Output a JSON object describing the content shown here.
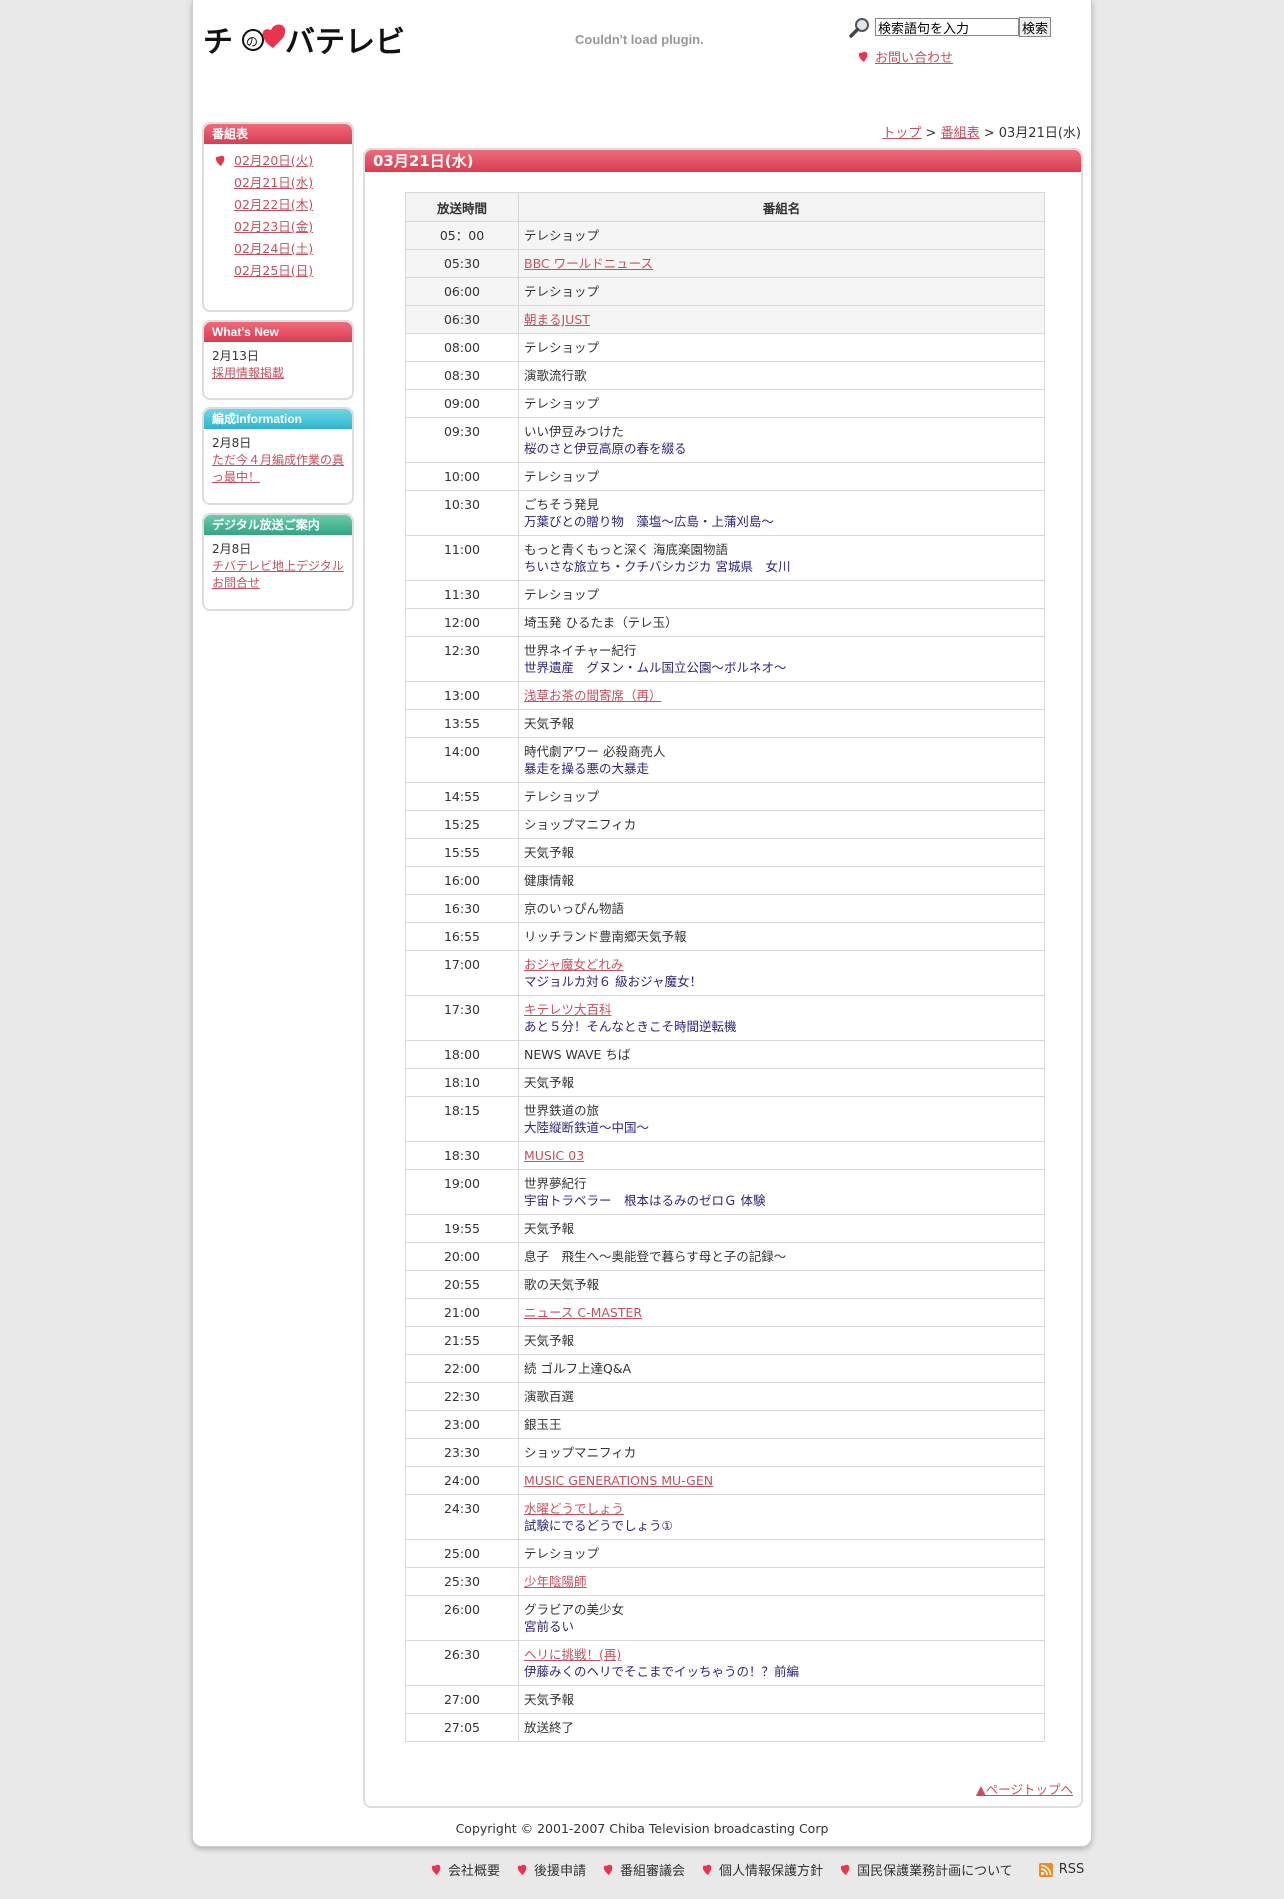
{
  "header": {
    "logo_text": "チバテレビ",
    "plugin_message": "Couldn't load plugin.",
    "search_placeholder": "検索語句を入力",
    "search_button": "検索",
    "contact_link": "お問い合わせ"
  },
  "sidebar": {
    "schedule": {
      "title": "番組表",
      "days": [
        "02月20日(火)",
        "02月21日(水)",
        "02月22日(木)",
        "02月23日(金)",
        "02月24日(土)",
        "02月25日(日)"
      ]
    },
    "whats_new": {
      "title": "What's New",
      "date": "2月13日",
      "link": "採用情報掲載"
    },
    "info": {
      "title": "編成Information",
      "date": "2月8日",
      "link": "ただ今４月編成作業の真っ最中！"
    },
    "digital": {
      "title": "デジタル放送ご案内",
      "date": "2月8日",
      "link": "チバテレビ地上デジタルお問合せ"
    }
  },
  "breadcrumb": {
    "top": "トップ",
    "sep1": " > ",
    "schedule": "番組表",
    "sep2": " > ",
    "current": "03月21日(水)"
  },
  "main": {
    "title": "03月21日(水)",
    "col_time": "放送時間",
    "col_name": "番組名",
    "rows": [
      {
        "time": "05：00",
        "name": "テレショップ",
        "link": false,
        "sub": ""
      },
      {
        "time": "05:30",
        "name": "BBC ワールドニュース",
        "link": true,
        "sub": ""
      },
      {
        "time": "06:00",
        "name": "テレショップ",
        "link": false,
        "sub": ""
      },
      {
        "time": "06:30",
        "name": "朝まるJUST",
        "link": true,
        "sub": ""
      },
      {
        "time": "08:00",
        "name": "テレショップ",
        "link": false,
        "sub": ""
      },
      {
        "time": "08:30",
        "name": "演歌流行歌",
        "link": false,
        "sub": ""
      },
      {
        "time": "09:00",
        "name": "テレショップ",
        "link": false,
        "sub": ""
      },
      {
        "time": "09:30",
        "name": "いい伊豆みつけた",
        "link": false,
        "sub": "桜のさと伊豆高原の春を綴る"
      },
      {
        "time": "10:00",
        "name": "テレショップ",
        "link": false,
        "sub": ""
      },
      {
        "time": "10:30",
        "name": "ごちそう発見",
        "link": false,
        "sub": "万葉びとの贈り物　藻塩～広島・上蒲刈島～"
      },
      {
        "time": "11:00",
        "name": "もっと青くもっと深く 海底楽園物語",
        "link": false,
        "sub": "ちいさな旅立ち・クチバシカジカ 宮城県　女川"
      },
      {
        "time": "11:30",
        "name": "テレショップ",
        "link": false,
        "sub": ""
      },
      {
        "time": "12:00",
        "name": "埼玉発 ひるたま（テレ玉）",
        "link": false,
        "sub": ""
      },
      {
        "time": "12:30",
        "name": "世界ネイチャー紀行",
        "link": false,
        "sub": "世界遺産　グヌン・ムル国立公園～ボルネオ～"
      },
      {
        "time": "13:00",
        "name": "浅草お茶の間寄席（再）",
        "link": true,
        "sub": ""
      },
      {
        "time": "13:55",
        "name": "天気予報",
        "link": false,
        "sub": ""
      },
      {
        "time": "14:00",
        "name": "時代劇アワー 必殺商売人",
        "link": false,
        "sub": "暴走を操る悪の大暴走"
      },
      {
        "time": "14:55",
        "name": "テレショップ",
        "link": false,
        "sub": ""
      },
      {
        "time": "15:25",
        "name": "ショップマニフィカ",
        "link": false,
        "sub": ""
      },
      {
        "time": "15:55",
        "name": "天気予報",
        "link": false,
        "sub": ""
      },
      {
        "time": "16:00",
        "name": "健康情報",
        "link": false,
        "sub": ""
      },
      {
        "time": "16:30",
        "name": "京のいっぴん物語",
        "link": false,
        "sub": ""
      },
      {
        "time": "16:55",
        "name": "リッチランド豊南郷天気予報",
        "link": false,
        "sub": ""
      },
      {
        "time": "17:00",
        "name": "おジャ魔女どれみ",
        "link": true,
        "sub": "マジョルカ対６ 級おジャ魔女！"
      },
      {
        "time": "17:30",
        "name": "キテレツ大百科",
        "link": true,
        "sub": "あと５分！そんなときこそ時間逆転機"
      },
      {
        "time": "18:00",
        "name": "NEWS WAVE ちば",
        "link": false,
        "sub": ""
      },
      {
        "time": "18:10",
        "name": "天気予報",
        "link": false,
        "sub": ""
      },
      {
        "time": "18:15",
        "name": "世界鉄道の旅",
        "link": false,
        "sub": "大陸縦断鉄道～中国～"
      },
      {
        "time": "18:30",
        "name": "MUSIC 03",
        "link": true,
        "sub": ""
      },
      {
        "time": "19:00",
        "name": "世界夢紀行",
        "link": false,
        "sub": "宇宙トラベラー　根本はるみのゼロＧ 体験"
      },
      {
        "time": "19:55",
        "name": "天気予報",
        "link": false,
        "sub": ""
      },
      {
        "time": "20:00",
        "name": "息子　飛生へ～奥能登で暮らす母と子の記録～",
        "link": false,
        "sub": ""
      },
      {
        "time": "20:55",
        "name": "歌の天気予報",
        "link": false,
        "sub": ""
      },
      {
        "time": "21:00",
        "name": "ニュース C-MASTER",
        "link": true,
        "sub": ""
      },
      {
        "time": "21:55",
        "name": "天気予報",
        "link": false,
        "sub": ""
      },
      {
        "time": "22:00",
        "name": "続 ゴルフ上達Q&A",
        "link": false,
        "sub": ""
      },
      {
        "time": "22:30",
        "name": "演歌百選",
        "link": false,
        "sub": ""
      },
      {
        "time": "23:00",
        "name": "銀玉王",
        "link": false,
        "sub": ""
      },
      {
        "time": "23:30",
        "name": "ショップマニフィカ",
        "link": false,
        "sub": ""
      },
      {
        "time": "24:00",
        "name": "MUSIC GENERATIONS MU-GEN",
        "link": true,
        "sub": ""
      },
      {
        "time": "24:30",
        "name": "水曜どうでしょう",
        "link": true,
        "sub": "試験にでるどうでしょう①"
      },
      {
        "time": "25:00",
        "name": "テレショップ",
        "link": false,
        "sub": ""
      },
      {
        "time": "25:30",
        "name": "少年陰陽師",
        "link": true,
        "sub": ""
      },
      {
        "time": "26:00",
        "name": "グラビアの美少女",
        "link": false,
        "sub": "宮前るい"
      },
      {
        "time": "26:30",
        "name": "ヘリに挑戦！(再)",
        "link": true,
        "sub": "伊藤みくのヘリでそこまでイッちゃうの！？前編"
      },
      {
        "time": "27:00",
        "name": "天気予報",
        "link": false,
        "sub": ""
      },
      {
        "time": "27:05",
        "name": "放送終了",
        "link": false,
        "sub": ""
      }
    ],
    "page_top": "▲ページトップへ"
  },
  "copyright": "Copyright © 2001-2007 Chiba Television broadcasting Corp",
  "footer": {
    "links": [
      "会社概要",
      "後援申請",
      "番組審議会",
      "個人情報保護方針",
      "国民保護業務計画について"
    ],
    "rss": "RSS"
  },
  "colors": {
    "accent_red": "#d83d52",
    "link": "#c8505e",
    "sub_text": "#2c2580",
    "info_cyan": "#2fb4cc",
    "digital_green": "#31a583"
  }
}
